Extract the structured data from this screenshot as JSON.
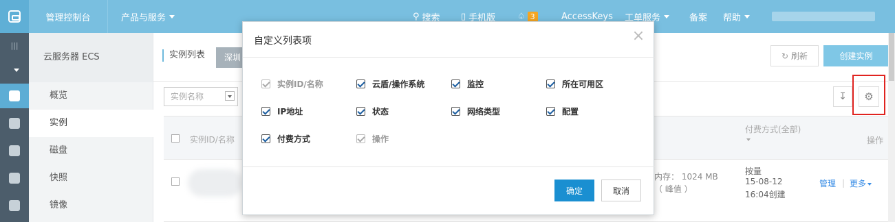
{
  "topbar": {
    "console": "管理控制台",
    "products": "产品与服务",
    "search": "搜索",
    "mobile": "手机版",
    "notification_count": "3",
    "accesskeys": "AccessKeys",
    "tickets": "工单服务",
    "beian": "备案",
    "help": "帮助"
  },
  "sidebar": {
    "title": "云服务器 ECS",
    "items": [
      "概览",
      "实例",
      "磁盘",
      "快照",
      "镜像"
    ]
  },
  "main": {
    "crumb": "实例列表",
    "region_tab": "深圳",
    "refresh": "刷新",
    "create": "创建实例",
    "search_select": "实例名称",
    "table": {
      "header_id": "实例ID/名称",
      "header_pay": "付费方式(全部)",
      "header_op": "操作",
      "row": {
        "mem1": "内存： 1024 MB",
        "mem2": "（ 峰值 ）",
        "pay1": "按量",
        "pay2": "15-08-12",
        "pay3": "16:04创建",
        "manage": "管理",
        "more": "更多"
      }
    }
  },
  "modal": {
    "title": "自定义列表项",
    "close": "×",
    "options": [
      {
        "label": "实例ID/名称",
        "checked": true,
        "disabled": true
      },
      {
        "label": "云盾/操作系统",
        "checked": true,
        "disabled": false
      },
      {
        "label": "监控",
        "checked": true,
        "disabled": false
      },
      {
        "label": "所在可用区",
        "checked": true,
        "disabled": false
      },
      {
        "label": "IP地址",
        "checked": true,
        "disabled": false
      },
      {
        "label": "状态",
        "checked": true,
        "disabled": false
      },
      {
        "label": "网络类型",
        "checked": true,
        "disabled": false
      },
      {
        "label": "配置",
        "checked": true,
        "disabled": false
      },
      {
        "label": "付费方式",
        "checked": true,
        "disabled": false
      },
      {
        "label": "操作",
        "checked": true,
        "disabled": true
      }
    ],
    "ok": "确定",
    "cancel": "取消"
  },
  "colors": {
    "topbar": "#79bfe0",
    "accent": "#1a8fd1",
    "highlight": "#e0231f"
  }
}
